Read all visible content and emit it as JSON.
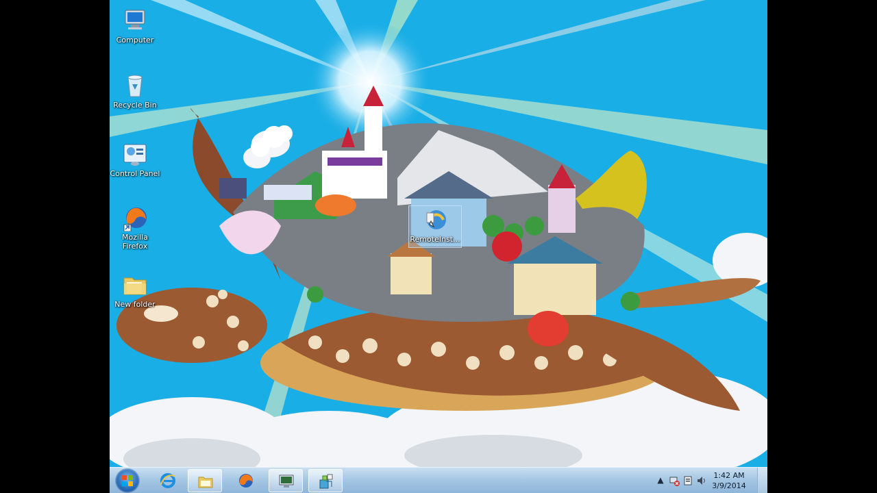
{
  "desktop": {
    "icons": [
      {
        "label": "Computer",
        "icon": "computer-icon"
      },
      {
        "label": "Recycle Bin",
        "icon": "recycle-bin-icon"
      },
      {
        "label": "Control Panel",
        "icon": "control-panel-icon"
      },
      {
        "label": "Mozilla Firefox",
        "icon": "firefox-icon"
      },
      {
        "label": "New folder",
        "icon": "folder-icon"
      },
      {
        "label": "RemoteInst...",
        "icon": "remote-install-icon"
      }
    ],
    "wallpaper": "turtle-island-illustration"
  },
  "taskbar": {
    "start": "windows-start-orb",
    "buttons": [
      {
        "icon": "internet-explorer-icon",
        "state": "pinned"
      },
      {
        "icon": "file-explorer-icon",
        "state": "open"
      },
      {
        "icon": "firefox-icon",
        "state": "pinned"
      },
      {
        "icon": "remote-desktop-icon",
        "state": "open"
      },
      {
        "icon": "setup-app-icon",
        "state": "open"
      }
    ],
    "tray": {
      "icons": [
        "show-hidden-icons-arrow",
        "network-disconnected-icon",
        "action-center-icon",
        "volume-icon"
      ],
      "time": "1:42 AM",
      "date": "3/9/2014"
    }
  },
  "colors": {
    "sky": "#19aee6",
    "taskbar": "#a6c7e4"
  }
}
